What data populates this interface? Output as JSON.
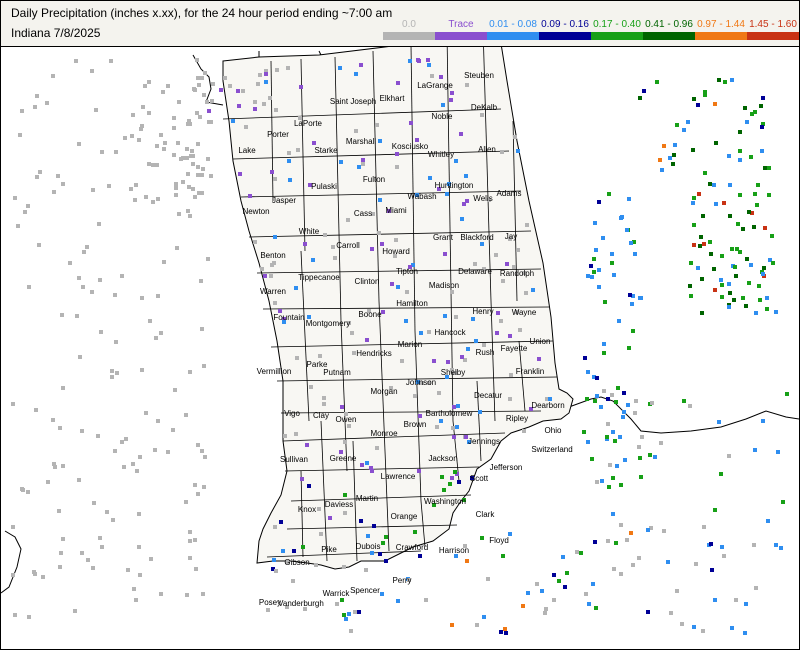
{
  "header": {
    "title": "Daily Precipitation (inches  x.xx),  for the 24 hour period ending ~7:00 am",
    "subtitle": "Indiana 7/8/2025"
  },
  "legend": [
    {
      "label": "0.0",
      "color": "#b4b4b4",
      "label_color": "#b4b4b4"
    },
    {
      "label": "Trace",
      "color": "#8a4fcf",
      "label_color": "#8a4fcf"
    },
    {
      "label": "0.01 - 0.08",
      "color": "#2f8ef0",
      "label_color": "#2f8ef0"
    },
    {
      "label": "0.09 - 0.16",
      "color": "#000096",
      "label_color": "#000096"
    },
    {
      "label": "0.17 - 0.40",
      "color": "#17a017",
      "label_color": "#17a017"
    },
    {
      "label": "0.41 - 0.96",
      "color": "#006400",
      "label_color": "#006400"
    },
    {
      "label": "0.97 - 1.44",
      "color": "#f07814",
      "label_color": "#f07814"
    },
    {
      "label": "1.45 - 1.60",
      "color": "#c83214",
      "label_color": "#c83214"
    }
  ],
  "counties": [
    {
      "name": "Lake"
    },
    {
      "name": "Porter"
    },
    {
      "name": "LaPorte"
    },
    {
      "name": "Saint Joseph"
    },
    {
      "name": "Elkhart"
    },
    {
      "name": "LaGrange"
    },
    {
      "name": "Steuben"
    },
    {
      "name": "Noble"
    },
    {
      "name": "DeKalb"
    },
    {
      "name": "Starke"
    },
    {
      "name": "Marshall"
    },
    {
      "name": "Kosciusko"
    },
    {
      "name": "Whitley"
    },
    {
      "name": "Allen"
    },
    {
      "name": "Jasper"
    },
    {
      "name": "Pulaski"
    },
    {
      "name": "Fulton"
    },
    {
      "name": "Huntington"
    },
    {
      "name": "Wabash"
    },
    {
      "name": "Wells"
    },
    {
      "name": "Adams"
    },
    {
      "name": "Newton"
    },
    {
      "name": "White"
    },
    {
      "name": "Cass"
    },
    {
      "name": "Miami"
    },
    {
      "name": "Carroll"
    },
    {
      "name": "Howard"
    },
    {
      "name": "Grant"
    },
    {
      "name": "Blackford"
    },
    {
      "name": "Jay"
    },
    {
      "name": "Benton"
    },
    {
      "name": "Tippecanoe"
    },
    {
      "name": "Clinton"
    },
    {
      "name": "Tipton"
    },
    {
      "name": "Delaware"
    },
    {
      "name": "Randolph"
    },
    {
      "name": "Warren"
    },
    {
      "name": "Madison"
    },
    {
      "name": "Fountain"
    },
    {
      "name": "Montgomery"
    },
    {
      "name": "Boone"
    },
    {
      "name": "Hamilton"
    },
    {
      "name": "Henry"
    },
    {
      "name": "Wayne"
    },
    {
      "name": "Hancock"
    },
    {
      "name": "Marion"
    },
    {
      "name": "Hendricks"
    },
    {
      "name": "Fayette"
    },
    {
      "name": "Union"
    },
    {
      "name": "Rush"
    },
    {
      "name": "Vermillion"
    },
    {
      "name": "Parke"
    },
    {
      "name": "Putnam"
    },
    {
      "name": "Shelby"
    },
    {
      "name": "Johnson"
    },
    {
      "name": "Morgan"
    },
    {
      "name": "Franklin"
    },
    {
      "name": "Decatur"
    },
    {
      "name": "Dearborn"
    },
    {
      "name": "Vigo"
    },
    {
      "name": "Clay"
    },
    {
      "name": "Owen"
    },
    {
      "name": "Monroe"
    },
    {
      "name": "Brown"
    },
    {
      "name": "Bartholomew"
    },
    {
      "name": "Ripley"
    },
    {
      "name": "Ohio"
    },
    {
      "name": "Jennings"
    },
    {
      "name": "Switzerland"
    },
    {
      "name": "Sullivan"
    },
    {
      "name": "Greene"
    },
    {
      "name": "Jackson"
    },
    {
      "name": "Lawrence"
    },
    {
      "name": "Jefferson"
    },
    {
      "name": "Scott"
    },
    {
      "name": "Knox"
    },
    {
      "name": "Daviess"
    },
    {
      "name": "Martin"
    },
    {
      "name": "Washington"
    },
    {
      "name": "Clark"
    },
    {
      "name": "Orange"
    },
    {
      "name": "Floyd"
    },
    {
      "name": "Gibson"
    },
    {
      "name": "Pike"
    },
    {
      "name": "Dubois"
    },
    {
      "name": "Crawford"
    },
    {
      "name": "Harrison"
    },
    {
      "name": "Posey"
    },
    {
      "name": "Vanderburgh"
    },
    {
      "name": "Warrick"
    },
    {
      "name": "Spencer"
    },
    {
      "name": "Perry"
    }
  ]
}
